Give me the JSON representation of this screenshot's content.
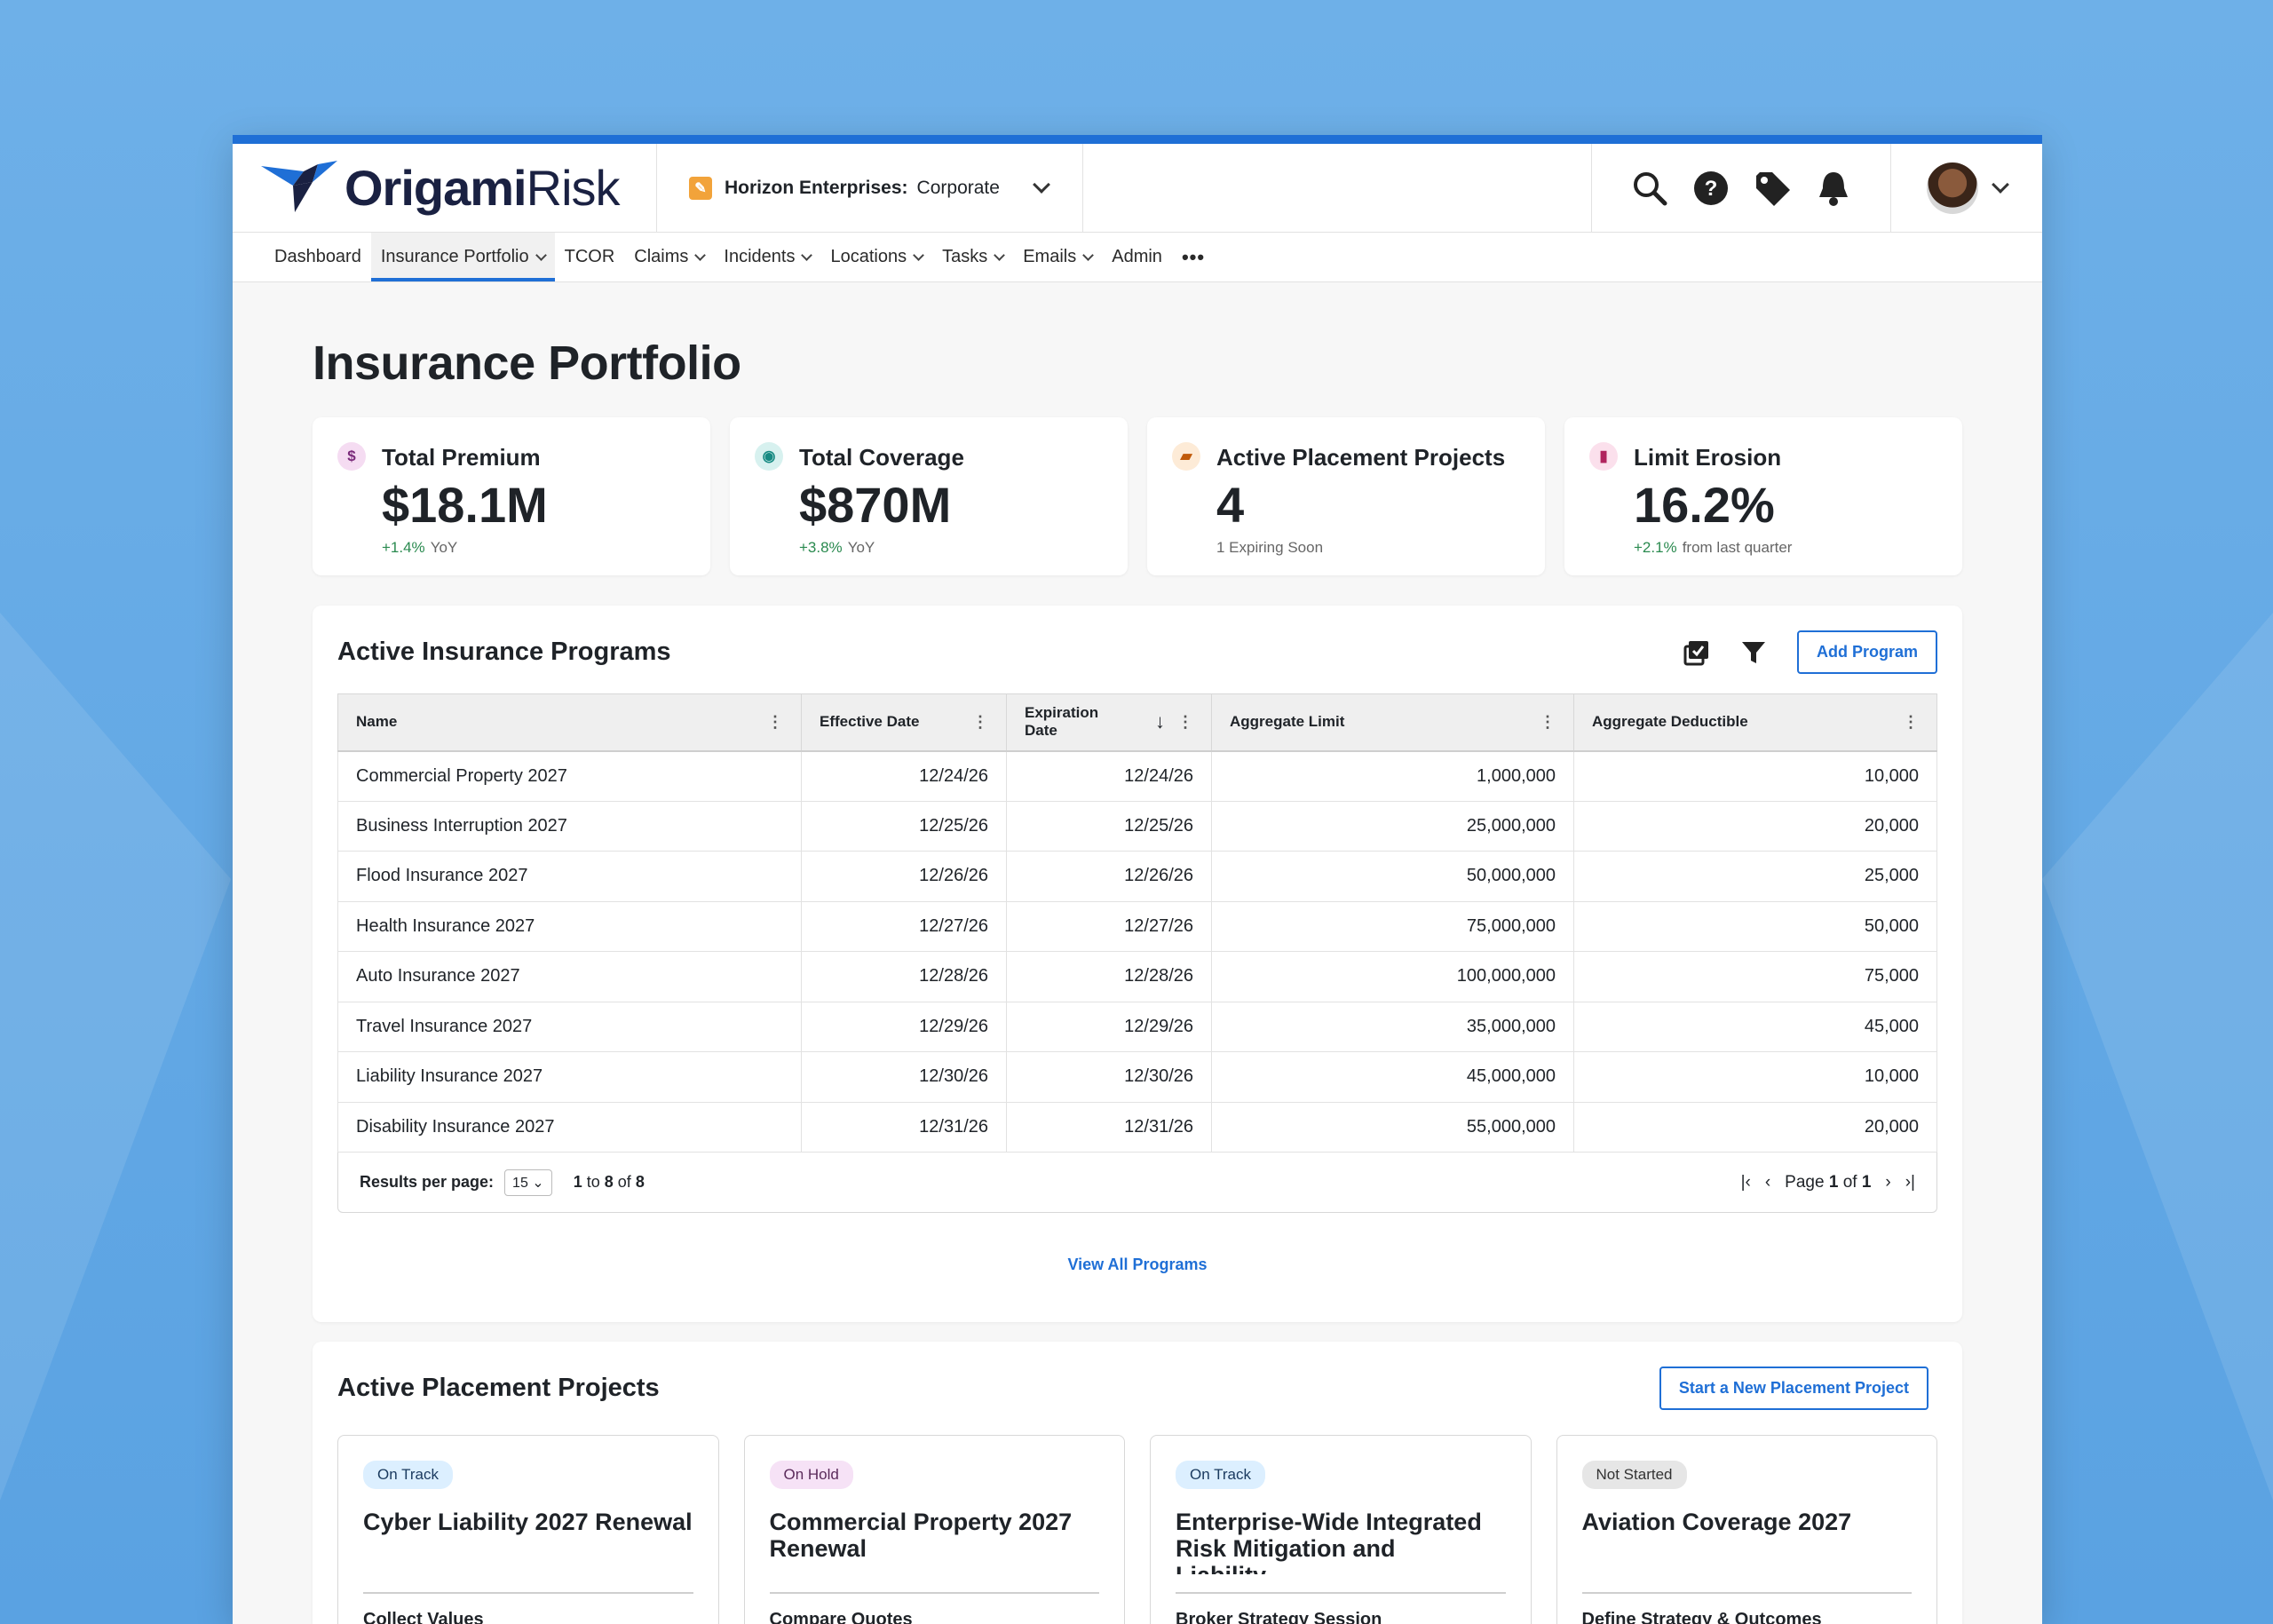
{
  "brand": {
    "name_bold": "Origami",
    "name_light": "Risk"
  },
  "org": {
    "name": "Horizon Enterprises:",
    "sub": "Corporate"
  },
  "nav": [
    {
      "label": "Dashboard",
      "dropdown": false
    },
    {
      "label": "Insurance Portfolio",
      "dropdown": true,
      "active": true
    },
    {
      "label": "TCOR",
      "dropdown": false
    },
    {
      "label": "Claims",
      "dropdown": true
    },
    {
      "label": "Incidents",
      "dropdown": true
    },
    {
      "label": "Locations",
      "dropdown": true
    },
    {
      "label": "Tasks",
      "dropdown": true
    },
    {
      "label": "Emails",
      "dropdown": true
    },
    {
      "label": "Admin",
      "dropdown": false
    }
  ],
  "page": {
    "title": "Insurance Portfolio"
  },
  "kpis": [
    {
      "label": "Total Premium",
      "value": "$18.1M",
      "delta": "+1.4%",
      "note": "YoY",
      "icon": "dollar-icon",
      "icon_glyph": "$",
      "icon_bg": "#f5dcf2",
      "icon_fg": "#7a2a7a"
    },
    {
      "label": "Total Coverage",
      "value": "$870M",
      "delta": "+3.8%",
      "note": "YoY",
      "icon": "eye-icon",
      "icon_glyph": "◉",
      "icon_bg": "#d7f1ef",
      "icon_fg": "#168a82"
    },
    {
      "label": "Active Placement Projects",
      "value": "4",
      "delta": "",
      "note": "1 Expiring Soon",
      "icon": "folder-icon",
      "icon_glyph": "▰",
      "icon_bg": "#fdebd7",
      "icon_fg": "#c05a0a"
    },
    {
      "label": "Limit Erosion",
      "value": "16.2%",
      "delta": "+2.1%",
      "note": "from last quarter",
      "icon": "bar-chart-icon",
      "icon_glyph": "▮",
      "icon_bg": "#fbe0ec",
      "icon_fg": "#b0245e"
    }
  ],
  "programs": {
    "title": "Active Insurance Programs",
    "add_label": "Add Program",
    "columns": [
      "Name",
      "Effective Date",
      "Expiration Date",
      "Aggregate Limit",
      "Aggregate Deductible"
    ],
    "rows": [
      [
        "Commercial Property 2027",
        "12/24/26",
        "12/24/26",
        "1,000,000",
        "10,000"
      ],
      [
        "Business Interruption 2027",
        "12/25/26",
        "12/25/26",
        "25,000,000",
        "20,000"
      ],
      [
        "Flood Insurance 2027",
        "12/26/26",
        "12/26/26",
        "50,000,000",
        "25,000"
      ],
      [
        "Health Insurance 2027",
        "12/27/26",
        "12/27/26",
        "75,000,000",
        "50,000"
      ],
      [
        "Auto Insurance 2027",
        "12/28/26",
        "12/28/26",
        "100,000,000",
        "75,000"
      ],
      [
        "Travel Insurance 2027",
        "12/29/26",
        "12/29/26",
        "35,000,000",
        "45,000"
      ],
      [
        "Liability Insurance 2027",
        "12/30/26",
        "12/30/26",
        "45,000,000",
        "10,000"
      ],
      [
        "Disability Insurance 2027",
        "12/31/26",
        "12/31/26",
        "55,000,000",
        "20,000"
      ]
    ],
    "footer": {
      "rpp_label": "Results per page:",
      "rpp_value": "15",
      "range_from": "1",
      "range_to_word": "to",
      "range_to": "8",
      "of_word": "of",
      "range_total": "8",
      "page_word": "Page",
      "page_current": "1",
      "page_of_word": "of",
      "page_total": "1"
    },
    "view_all": "View All Programs"
  },
  "placements": {
    "title": "Active Placement Projects",
    "new_label": "Start a New Placement Project",
    "cards": [
      {
        "status": "On Track",
        "status_class": "ontrack",
        "title": "Cyber Liability 2027 Renewal",
        "step": "Collect Values"
      },
      {
        "status": "On Hold",
        "status_class": "onhold",
        "title": "Commercial Property 2027 Renewal",
        "step": "Compare Quotes"
      },
      {
        "status": "On Track",
        "status_class": "ontrack",
        "title": "Enterprise-Wide Integrated Risk Mitigation and Liability…",
        "step": "Broker Strategy Session"
      },
      {
        "status": "Not Started",
        "status_class": "notstarted",
        "title": "Aviation Coverage 2027",
        "step": "Define Strategy & Outcomes"
      }
    ]
  },
  "colors": {
    "accent": "#1f6fd6",
    "positive": "#2a8a4f",
    "background": "#5aa2e2"
  }
}
